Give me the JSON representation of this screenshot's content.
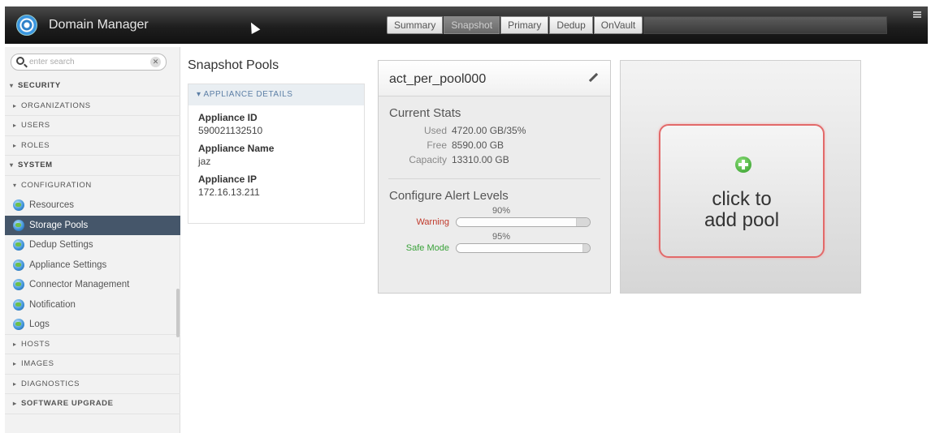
{
  "app": {
    "title": "Domain Manager"
  },
  "tabs": [
    {
      "label": "Summary",
      "active": false
    },
    {
      "label": "Snapshot",
      "active": true
    },
    {
      "label": "Primary",
      "active": false
    },
    {
      "label": "Dedup",
      "active": false
    },
    {
      "label": "OnVault",
      "active": false
    }
  ],
  "search": {
    "placeholder": "enter search",
    "clear_glyph": "✕"
  },
  "sidebar": {
    "security": "SECURITY",
    "organizations": "ORGANIZATIONS",
    "users": "USERS",
    "roles": "ROLES",
    "system": "SYSTEM",
    "configuration": "CONFIGURATION",
    "items": [
      "Resources",
      "Storage Pools",
      "Dedup Settings",
      "Appliance Settings",
      "Connector Management",
      "Notification",
      "Logs"
    ],
    "selected_item": "Storage Pools",
    "hosts": "HOSTS",
    "images": "IMAGES",
    "diagnostics": "DIAGNOSTICS",
    "software_upgrade": "SOFTWARE UPGRADE"
  },
  "main": {
    "title": "Snapshot Pools",
    "details_header": "APPLIANCE DETAILS",
    "appliance_id_label": "Appliance ID",
    "appliance_id": "590021132510",
    "appliance_name_label": "Appliance Name",
    "appliance_name": "jaz",
    "appliance_ip_label": "Appliance IP",
    "appliance_ip": "172.16.13.211"
  },
  "pool": {
    "name": "act_per_pool000",
    "current_stats_title": "Current Stats",
    "used_label": "Used",
    "used_value": "4720.00 GB/35%",
    "free_label": "Free",
    "free_value": "8590.00 GB",
    "capacity_label": "Capacity",
    "capacity_value": "13310.00 GB",
    "alert_title": "Configure Alert Levels",
    "warning_pct": "90%",
    "warning_label": "Warning",
    "warning_level": 0.9,
    "safe_pct": "95%",
    "safe_label": "Safe Mode",
    "safe_level": 0.95
  },
  "add_pool": {
    "line1": "click to",
    "line2": "add pool"
  },
  "colors": {
    "accent": "#45566a",
    "warning": "#c0392b",
    "safe": "#3aa23a",
    "add_border": "#e26a6a"
  }
}
